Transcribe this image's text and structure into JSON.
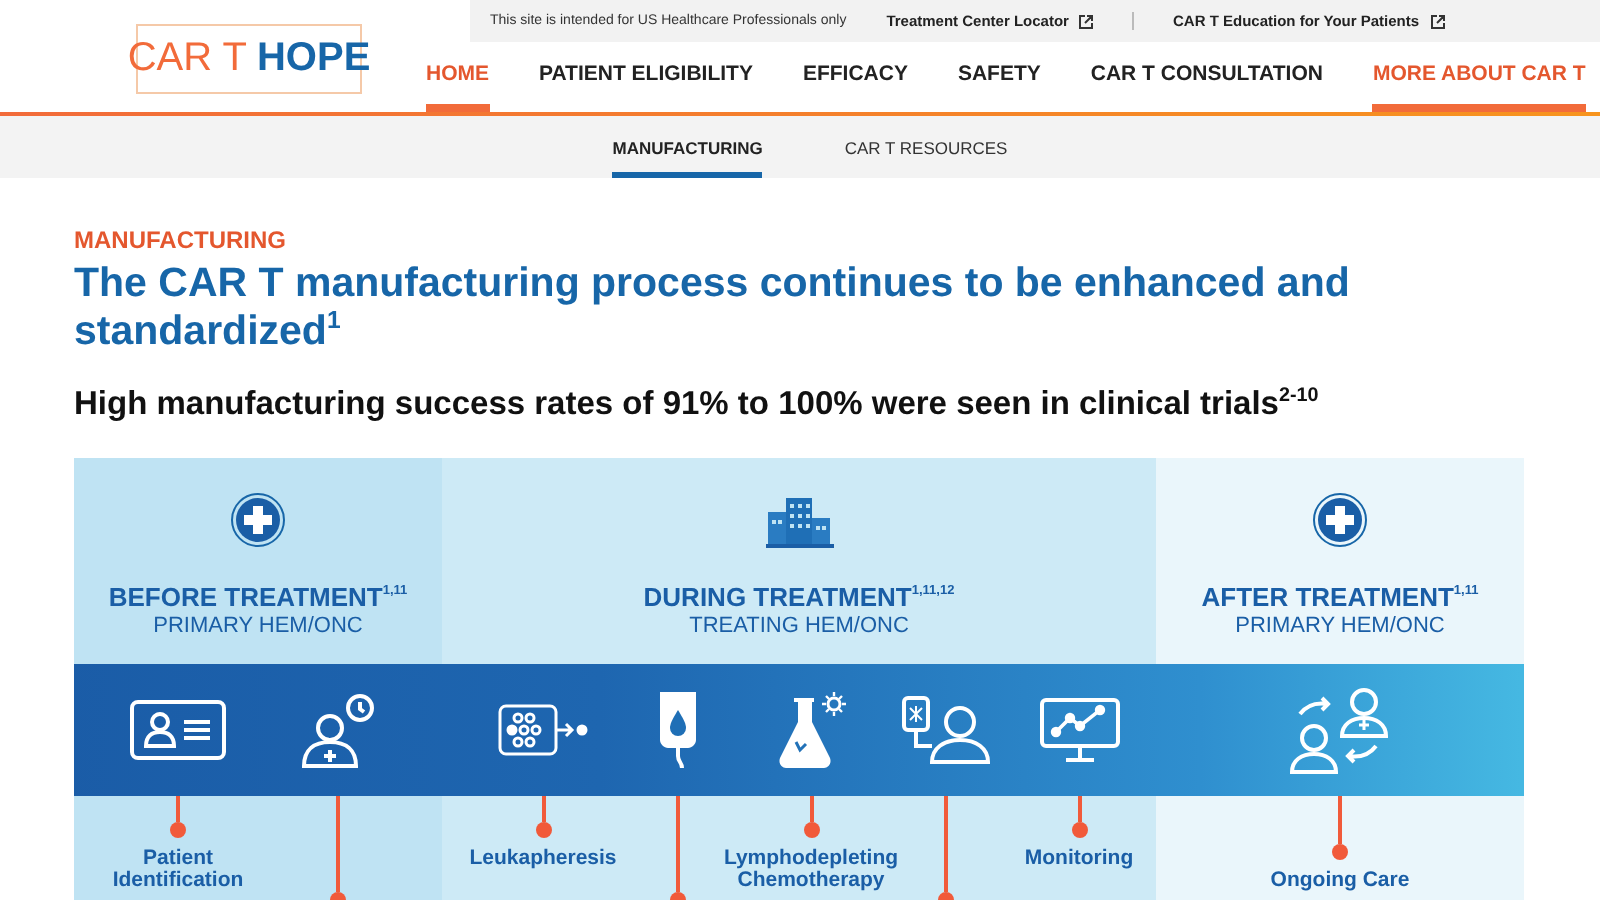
{
  "header": {
    "logo": {
      "first": "CAR T",
      "second": "HOPE"
    },
    "notice": "This site is intended for US Healthcare Professionals only",
    "links": [
      {
        "label": "Treatment Center Locator"
      },
      {
        "label": "CAR T Education for Your Patients"
      }
    ],
    "nav": [
      {
        "label": "HOME",
        "selected": true
      },
      {
        "label": "PATIENT ELIGIBILITY",
        "selected": false
      },
      {
        "label": "EFFICACY",
        "selected": false
      },
      {
        "label": "SAFETY",
        "selected": false
      },
      {
        "label": "CAR T CONSULTATION",
        "selected": false
      },
      {
        "label": "MORE ABOUT CAR T",
        "selected": true
      }
    ]
  },
  "subnav": [
    {
      "label": "MANUFACTURING",
      "selected": true
    },
    {
      "label": "CAR T RESOURCES",
      "selected": false
    }
  ],
  "intro": {
    "eyebrow": "MANUFACTURING",
    "title": "The CAR T manufacturing process continues to be enhanced and standardized$^{1}$",
    "subtitle": "High manufacturing success rates of 91% to 100% were seen in clinical trials$^{2-10}$"
  },
  "phases": [
    {
      "title": "BEFORE TREATMENT$^{1,11}$",
      "subtitle": "PRIMARY HEM/ONC",
      "kind": "plus",
      "steps": [
        {
          "kind": "id-card",
          "label": "Patient Identification"
        },
        {
          "kind": "person-clock"
        }
      ]
    },
    {
      "title": "DURING TREATMENT$^{1,11,12}$",
      "subtitle": "TREATING HEM/ONC",
      "kind": "buildings",
      "steps": [
        {
          "kind": "cells",
          "label": "Leukapheresis"
        },
        {
          "kind": "iv-bag"
        },
        {
          "kind": "flask",
          "label": "Lymphodepleting Chemotherapy"
        },
        {
          "kind": "iv-person"
        },
        {
          "kind": "monitor",
          "label": "Monitoring"
        }
      ]
    },
    {
      "title": "AFTER TREATMENT$^{1,11}$",
      "subtitle": "PRIMARY HEM/ONC",
      "kind": "plus",
      "steps": [
        {
          "kind": "people-swap",
          "label": "Ongoing Care"
        }
      ]
    }
  ]
}
